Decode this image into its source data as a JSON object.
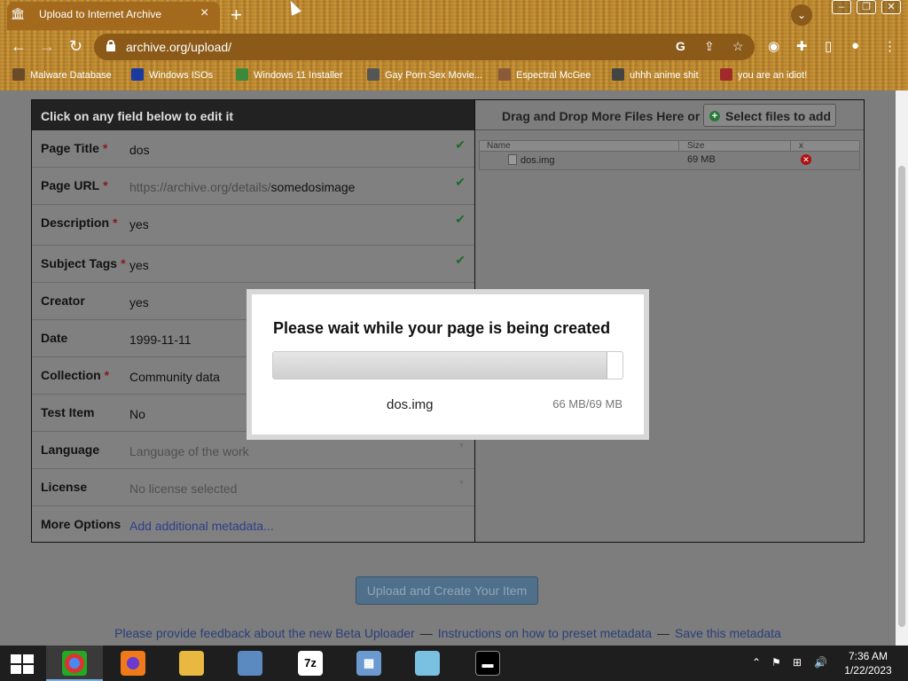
{
  "browser": {
    "tab_title": "Upload to Internet Archive",
    "tab_close": "×",
    "new_tab": "+",
    "url": "archive.org/upload/",
    "bookmarks": [
      {
        "label": "Malware Database",
        "color": "#6b4a2a"
      },
      {
        "label": "Windows ISOs",
        "color": "#1a3aa0"
      },
      {
        "label": "Windows 11 Installer",
        "color": "#3a8a3a"
      },
      {
        "label": "Gay Porn Sex Movie...",
        "color": "#555555"
      },
      {
        "label": "Espectral McGee",
        "color": "#8a5a3a"
      },
      {
        "label": "uhhh anime shit",
        "color": "#444444"
      },
      {
        "label": "you are an idiot!",
        "color": "#a02a2a"
      }
    ]
  },
  "form": {
    "header": "Click on any field below to edit it",
    "fields": [
      {
        "label": "Page Title",
        "required": "*",
        "value": "dos",
        "check": "✔"
      },
      {
        "label": "Page URL",
        "required": "*",
        "value_prefix": "https://archive.org/details/",
        "value": "somedosimage",
        "check": "✔"
      },
      {
        "label": "Description",
        "required": "*",
        "value": "yes",
        "check": "✔"
      },
      {
        "label": "Subject Tags",
        "required": "*",
        "value": "yes",
        "check": "✔"
      },
      {
        "label": "Creator",
        "required": "",
        "value": "yes"
      },
      {
        "label": "Date",
        "required": "",
        "value": "1999-11-11"
      },
      {
        "label": "Collection",
        "required": "*",
        "value": "Community data"
      },
      {
        "label": "Test Item",
        "required": "",
        "value": "No"
      },
      {
        "label": "Language",
        "required": "",
        "value": "Language of the work"
      },
      {
        "label": "License",
        "required": "",
        "value": "No license selected"
      },
      {
        "label": "More Options",
        "required": "",
        "value": "Add additional metadata..."
      }
    ]
  },
  "files": {
    "drop_text": "Drag and Drop More Files Here or",
    "select_button": "Select files to add",
    "columns": [
      "Name",
      "Size",
      "x"
    ],
    "rows": [
      {
        "name": "dos.img",
        "size": "69 MB"
      }
    ]
  },
  "upload_button": "Upload and Create Your Item",
  "footer": {
    "links": [
      "Please provide feedback about the new Beta Uploader",
      "Instructions on how to preset metadata",
      "Save this metadata"
    ],
    "separator": "—"
  },
  "modal": {
    "title": "Please wait while your page is being created",
    "file": "dos.img",
    "progress_text": "66 MB/69 MB",
    "progress_fraction": 0.957
  },
  "taskbar": {
    "time": "7:36 AM",
    "date": "1/22/2023",
    "items": [
      "chrome-icon",
      "firefox-icon",
      "file-explorer-icon",
      "network-tool-icon",
      "7zip-icon",
      "calculator-icon",
      "notepad-icon",
      "command-prompt-icon"
    ]
  }
}
